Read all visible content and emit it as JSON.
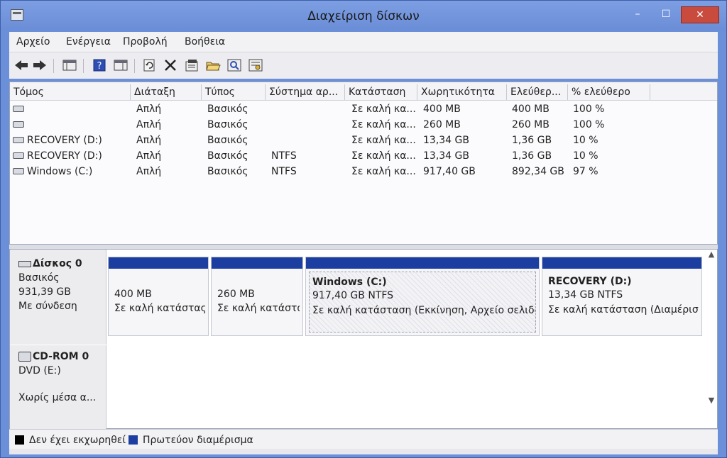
{
  "window": {
    "title": "Διαχείριση δίσκων",
    "minimize_glyph": "–",
    "maximize_glyph": "☐",
    "close_glyph": "✕"
  },
  "menu": {
    "items": [
      "Αρχείο",
      "Ενέργεια",
      "Προβολή",
      "Βοήθεια"
    ]
  },
  "toolbar": {
    "icons": [
      "back-arrow-icon",
      "forward-arrow-icon",
      "console-tree-icon",
      "help-icon",
      "show-hide-pane-icon",
      "refresh-icon",
      "delete-icon",
      "properties-icon",
      "open-folder-icon",
      "search-icon",
      "settings-icon"
    ]
  },
  "volume_list": {
    "columns": [
      "Τόμος",
      "Διάταξη",
      "Τύπος",
      "Σύστημα αρ...",
      "Κατάσταση",
      "Χωρητικότητα",
      "Ελεύθερ...",
      "% ελεύθερο"
    ],
    "rows": [
      {
        "volume": "",
        "layout": "Απλή",
        "type": "Βασικός",
        "fs": "",
        "status": "Σε καλή κα...",
        "capacity": "400 MB",
        "free": "400 MB",
        "pct": "100 %"
      },
      {
        "volume": "",
        "layout": "Απλή",
        "type": "Βασικός",
        "fs": "",
        "status": "Σε καλή κα...",
        "capacity": "260 MB",
        "free": "260 MB",
        "pct": "100 %"
      },
      {
        "volume": "RECOVERY (D:)",
        "layout": "Απλή",
        "type": "Βασικός",
        "fs": "",
        "status": "Σε καλή κα...",
        "capacity": "13,34 GB",
        "free": "1,36 GB",
        "pct": "10 %"
      },
      {
        "volume": "RECOVERY (D:)",
        "layout": "Απλή",
        "type": "Βασικός",
        "fs": "NTFS",
        "status": "Σε καλή κα...",
        "capacity": "13,34 GB",
        "free": "1,36 GB",
        "pct": "10 %"
      },
      {
        "volume": "Windows (C:)",
        "layout": "Απλή",
        "type": "Βασικός",
        "fs": "NTFS",
        "status": "Σε καλή κα...",
        "capacity": "917,40 GB",
        "free": "892,34 GB",
        "pct": "97 %"
      }
    ]
  },
  "disk0": {
    "name": "Δίσκος 0",
    "type": "Βασικός",
    "size": "931,39 GB",
    "state": "Με σύνδεση",
    "partitions": [
      {
        "title": "",
        "line1": "400 MB",
        "line2": "Σε καλή κατάστας"
      },
      {
        "title": "",
        "line1": "260 MB",
        "line2": "Σε καλή κατάστα"
      },
      {
        "title": "Windows  (C:)",
        "line1": "917,40 GB NTFS",
        "line2": "Σε καλή κατάσταση (Εκκίνηση, Αρχείο σελιδο"
      },
      {
        "title": "RECOVERY  (D:)",
        "line1": "13,34 GB NTFS",
        "line2": "Σε καλή κατάσταση (Διαμέρισ"
      }
    ]
  },
  "cdrom0": {
    "name": "CD-ROM 0",
    "drive": "DVD (E:)",
    "state": "Χωρίς μέσα α..."
  },
  "legend": {
    "items": [
      {
        "label": "Δεν έχει εκχωρηθεί",
        "color": "#000000"
      },
      {
        "label": "Πρωτεύον διαμέρισμα",
        "color": "#1c3ea1"
      }
    ]
  },
  "colors": {
    "partition_bar": "#1c3ea1",
    "titlebar": "#6a8dd7",
    "close_button": "#c84b3d"
  }
}
